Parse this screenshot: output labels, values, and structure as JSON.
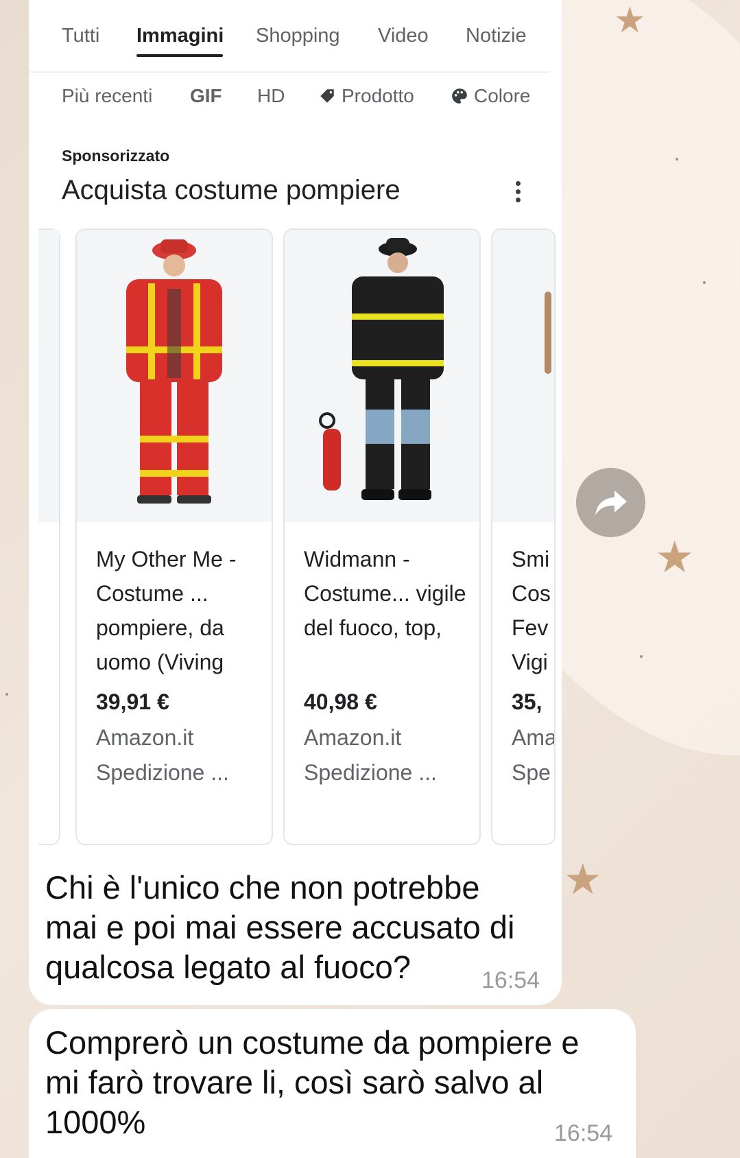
{
  "tabs": {
    "items": [
      "Tutti",
      "Immagini",
      "Shopping",
      "Video",
      "Notizie"
    ],
    "active": "Immagini"
  },
  "filters": {
    "items": [
      "Più recenti",
      "GIF",
      "HD",
      "Prodotto",
      "Colore"
    ]
  },
  "sponsored_label": "Sponsorizzato",
  "carousel_title": "Acquista costume pompiere",
  "products": [
    {
      "title": "My Other Me - Costume ... pompiere, da uomo (Viving",
      "price": "39,91 €",
      "merchant": "Amazon.it",
      "shipping": "Spedizione ..."
    },
    {
      "title": "Widmann - Costume... vigile del fuoco, top,",
      "price": "40,98 €",
      "merchant": "Amazon.it",
      "shipping": "Spedizione ..."
    },
    {
      "title": "Smi Cos Fev Vigi",
      "price": "35,",
      "merchant": "Ama",
      "shipping": "Spe"
    }
  ],
  "messages": [
    {
      "text": "Chi è l'unico che non potrebbe mai e poi mai essere accusato di qualcosa legato al fuoco?",
      "time": "16:54"
    },
    {
      "text": "Comprerò un costume da pompiere e mi farò trovare li, così sarò salvo al 1000%",
      "time": "16:54"
    }
  ],
  "icons": {
    "forward": "forward-arrow-icon",
    "more": "more-vert-icon",
    "tag": "tag-icon",
    "palette": "palette-icon"
  },
  "colors": {
    "chat_background": "#ece0d4",
    "bubble": "#ffffff",
    "timestamp": "#9a9a9a",
    "star": "#c9a27e"
  }
}
